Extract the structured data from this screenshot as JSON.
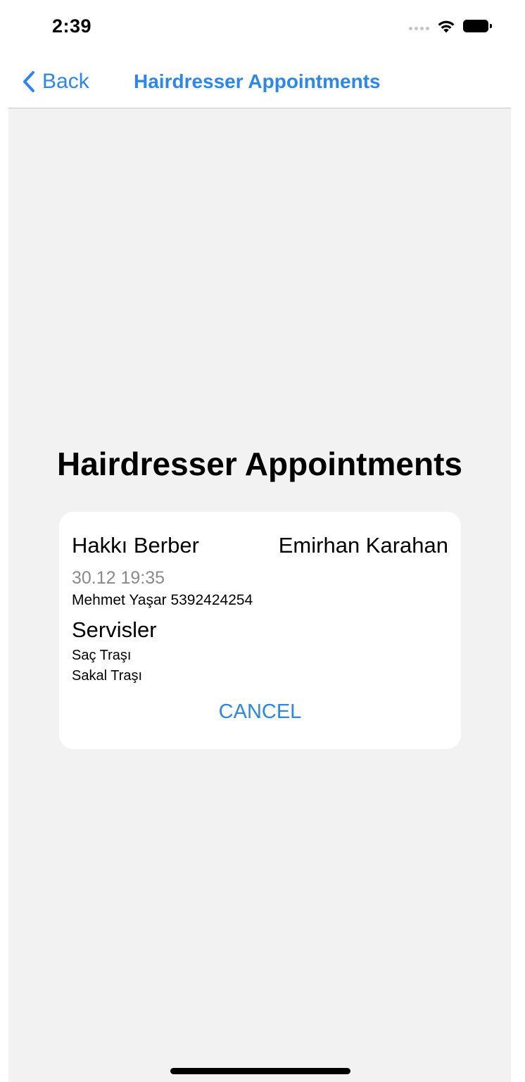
{
  "status_bar": {
    "time": "2:39",
    "icons": [
      "cellular-signal-icon",
      "wifi-icon",
      "battery-icon"
    ]
  },
  "nav": {
    "back_label": "Back",
    "back_icon": "chevron-left-icon",
    "title": "Hairdresser Appointments",
    "accent_color": "#2a86f0"
  },
  "main": {
    "title": "Hairdresser Appointments",
    "appointments": [
      {
        "shop": "Hakkı Berber",
        "barber": "Emirhan Karahan",
        "datetime": "30.12 19:35",
        "customer": "Mehmet Yaşar 5392424254",
        "services_heading": "Servisler",
        "services": [
          "Saç Traşı",
          "Sakal Traşı"
        ],
        "cancel_label": "CANCEL"
      }
    ]
  }
}
